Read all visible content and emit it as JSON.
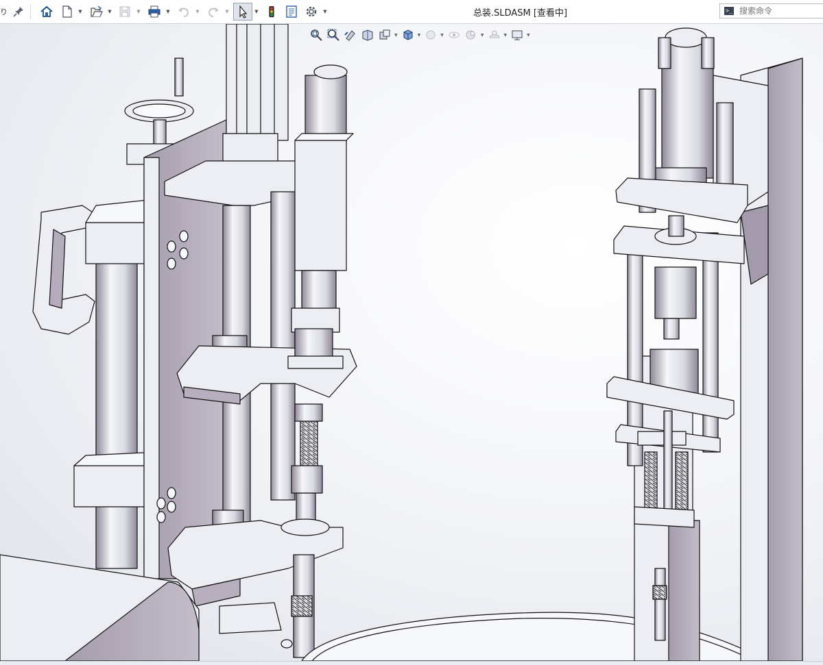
{
  "window": {
    "title": "总装.SLDASM [查看中]",
    "left_cutoff_text": "り"
  },
  "toolbar": {
    "items": [
      {
        "name": "pin-icon"
      },
      {
        "name": "home-icon"
      },
      {
        "name": "new-document-icon",
        "has_dropdown": true
      },
      {
        "name": "open-file-icon",
        "has_dropdown": true
      },
      {
        "name": "save-icon",
        "has_dropdown": true,
        "disabled": true
      },
      {
        "name": "print-icon",
        "has_dropdown": true
      },
      {
        "name": "undo-icon",
        "has_dropdown": true,
        "disabled": true
      },
      {
        "name": "redo-icon",
        "has_dropdown": true,
        "disabled": true
      },
      {
        "name": "select-cursor-icon",
        "has_dropdown": true,
        "active": true
      },
      {
        "name": "traffic-light-icon"
      },
      {
        "name": "file-properties-icon"
      },
      {
        "name": "options-gear-icon",
        "has_dropdown": true
      }
    ]
  },
  "search": {
    "placeholder": "搜索命令",
    "prompt_symbol": ">_"
  },
  "heads_up_toolbar": {
    "items": [
      {
        "name": "zoom-to-fit-icon"
      },
      {
        "name": "zoom-to-area-icon"
      },
      {
        "name": "previous-view-icon"
      },
      {
        "name": "section-view-icon"
      },
      {
        "name": "dynamic-annotation-views-icon",
        "has_dropdown": true
      },
      {
        "name": "view-orientation-icon",
        "has_dropdown": true
      },
      {
        "name": "display-style-icon",
        "has_dropdown": true
      },
      {
        "name": "hide-show-items-icon",
        "has_dropdown": true
      },
      {
        "name": "edit-appearance-icon",
        "has_dropdown": true
      },
      {
        "name": "apply-scene-icon",
        "has_dropdown": true
      },
      {
        "name": "view-settings-icon",
        "has_dropdown": true
      }
    ]
  },
  "colors": {
    "part_fill": "#eceef3",
    "part_shadow": "#9d95a6",
    "part_shade_dark": "#7e758a",
    "edge": "#111111",
    "viewport_bg_center": "#ffffff",
    "viewport_bg_edge": "#dfe2ea",
    "accent_blue": "#2a5fa8",
    "traffic_red": "#d23a2a",
    "traffic_yellow": "#e8b21e",
    "traffic_green": "#2f9a3c"
  }
}
